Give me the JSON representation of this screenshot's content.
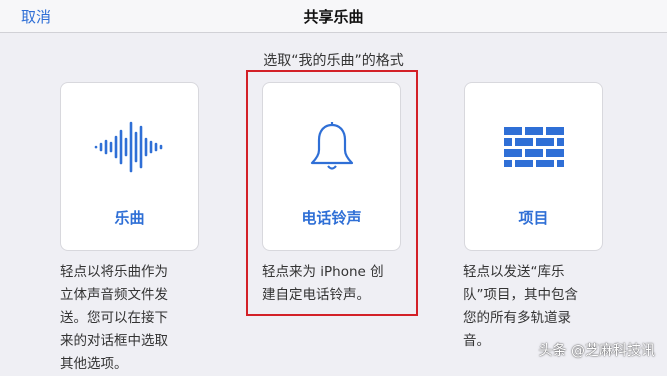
{
  "nav": {
    "cancel_label": "取消",
    "title": "共享乐曲"
  },
  "subtitle": "选取“我的乐曲”的格式",
  "options": [
    {
      "label": "乐曲",
      "icon": "waveform-icon",
      "desc": "轻点以将乐曲作为\n立体声音频文件发\n送。您可以在接下\n来的对话框中选取\n其他选项。"
    },
    {
      "label": "电话铃声",
      "icon": "bell-icon",
      "desc": "轻点来为 iPhone 创\n建自定电话铃声。"
    },
    {
      "label": "项目",
      "icon": "brick-grid-icon",
      "desc": "轻点以发送“库乐\n队”项目，其中包含\n您的所有多轨道录\n音。"
    }
  ],
  "colors": {
    "accent": "#2f6fd6",
    "highlight_box": "#d32027",
    "background": "#efeff4"
  },
  "watermark": "头条 @芝麻科技讯"
}
